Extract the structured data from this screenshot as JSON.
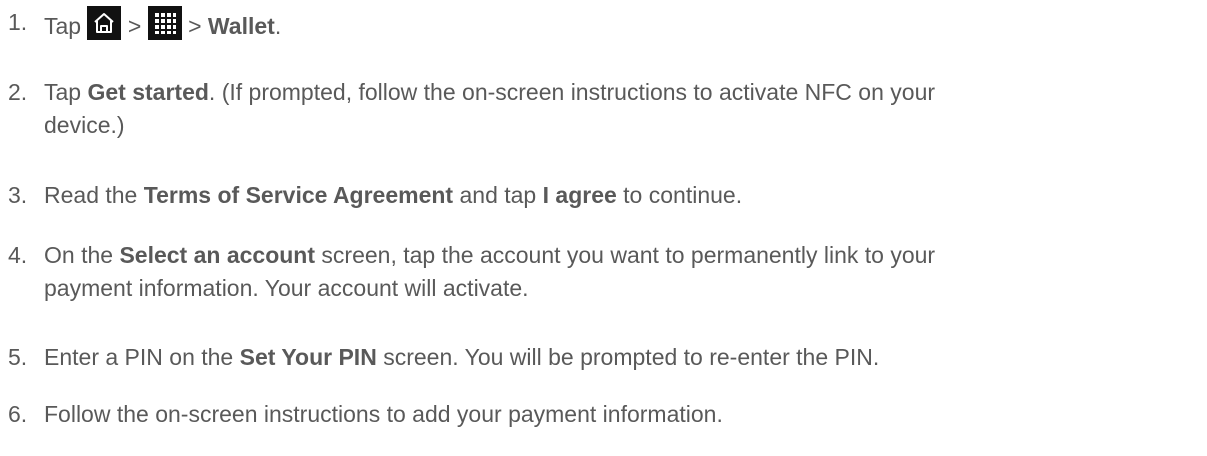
{
  "steps": [
    {
      "number": "1.",
      "tap": "Tap",
      "sep1": ">",
      "sep2": ">",
      "wallet": "Wallet",
      "end": ".",
      "icons": [
        "home-icon",
        "apps-grid-icon"
      ]
    },
    {
      "number": "2.",
      "pre": "Tap",
      "bold": "Get started",
      "post": ". (If prompted, follow the on-screen instructions to activate NFC on your",
      "post2": "device.)"
    },
    {
      "number": "3.",
      "pre": "Read the",
      "bold1": "Terms of Service Agreement",
      "mid": "and tap",
      "bold2": "I agree",
      "post": "to continue."
    },
    {
      "number": "4.",
      "pre": "On the",
      "bold": "Select an account",
      "post": "screen, tap the account you want to permanently link to your",
      "post2": "payment information. Your account will activate."
    },
    {
      "number": "5.",
      "pre": "Enter a PIN on the",
      "bold": "Set Your PIN",
      "post": "screen. You will be prompted to re-enter the PIN."
    },
    {
      "number": "6.",
      "text": "Follow the on-screen instructions to add your payment information."
    }
  ]
}
